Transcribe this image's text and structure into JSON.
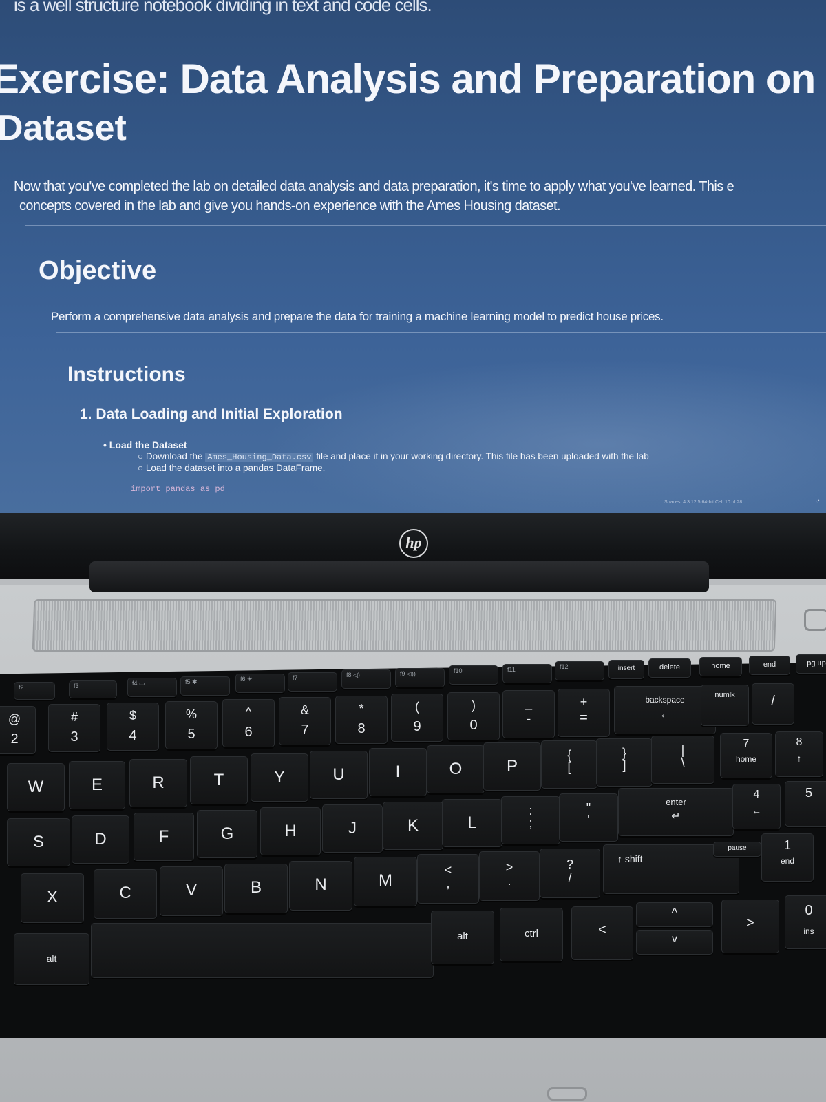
{
  "screen": {
    "top_cut_text": "is a well structure notebook dividing in text and code cells.",
    "title_line1": "Exercise: Data Analysis and Preparation on the Am",
    "title_line2": "Dataset",
    "intro_line1": "Now that you've completed the lab on detailed data analysis and data preparation, it's time to apply what you've learned. This e",
    "intro_line2": "concepts covered in the lab and give you hands-on experience with the Ames Housing dataset.",
    "objective_heading": "Objective",
    "objective_text": "Perform a comprehensive data analysis and prepare the data for training a machine learning model to predict house prices.",
    "instructions_heading": "Instructions",
    "step1_heading": "1. Data Loading and Initial Exploration",
    "bullet_load": "Load the Dataset",
    "sub_download_prefix": "Download the",
    "sub_download_file": "Ames_Housing_Data.csv",
    "sub_download_suffix": "file and place it in your working directory. This file has been uploaded with the lab",
    "sub_load": "Load the dataset into a pandas DataFrame.",
    "code_line": "import pandas as pd",
    "status_bar": "Spaces: 4   3.12.5 64-bit   Cell 10 of 28"
  },
  "laptop": {
    "logo": "hp"
  },
  "keys": {
    "row_num": [
      "2",
      "3",
      "4",
      "5",
      "6",
      "7",
      "8",
      "9",
      "0"
    ],
    "row_num_top": [
      "@",
      "#",
      "$",
      "%",
      "^",
      "&",
      "*",
      "(",
      ")"
    ],
    "minus": "-",
    "minus_top": "_",
    "equals": "=",
    "equals_top": "+",
    "backspace": "backspace",
    "insert": "insert",
    "delete": "delete",
    "home": "home",
    "end": "end",
    "pgup": "pg up",
    "numlk": "numlk",
    "row_q": [
      "W",
      "E",
      "R",
      "T",
      "Y",
      "U",
      "I",
      "O",
      "P"
    ],
    "bracket_l": "[",
    "bracket_l_top": "{",
    "bracket_r": "]",
    "bracket_r_top": "}",
    "backslash": "\\",
    "backslash_top": "|",
    "row_a": [
      "S",
      "D",
      "F",
      "G",
      "H",
      "J",
      "K",
      "L"
    ],
    "semicolon": ";",
    "semicolon_top": ":",
    "quote": "'",
    "quote_top": "\"",
    "enter": "enter",
    "row_z": [
      "X",
      "C",
      "V",
      "B",
      "N",
      "M"
    ],
    "comma": ",",
    "comma_top": "<",
    "period": ".",
    "period_top": ">",
    "slash": "/",
    "slash_top": "?",
    "shift": "↑ shift",
    "alt_left": "alt",
    "alt_right": "alt",
    "ctrl": "ctrl",
    "pause": "pause",
    "num7": "7",
    "num7_sub": "home",
    "num8": "8",
    "num8_sub": "↑",
    "num4": "4",
    "num4_sub": "←",
    "num5": "5",
    "num1": "1",
    "num1_sub": "end",
    "num0": "0",
    "num0_sub": "ins",
    "numslash": "/",
    "numgt": ">",
    "arrow_up": "^",
    "arrow_down": "v",
    "arrow_left": "<"
  }
}
